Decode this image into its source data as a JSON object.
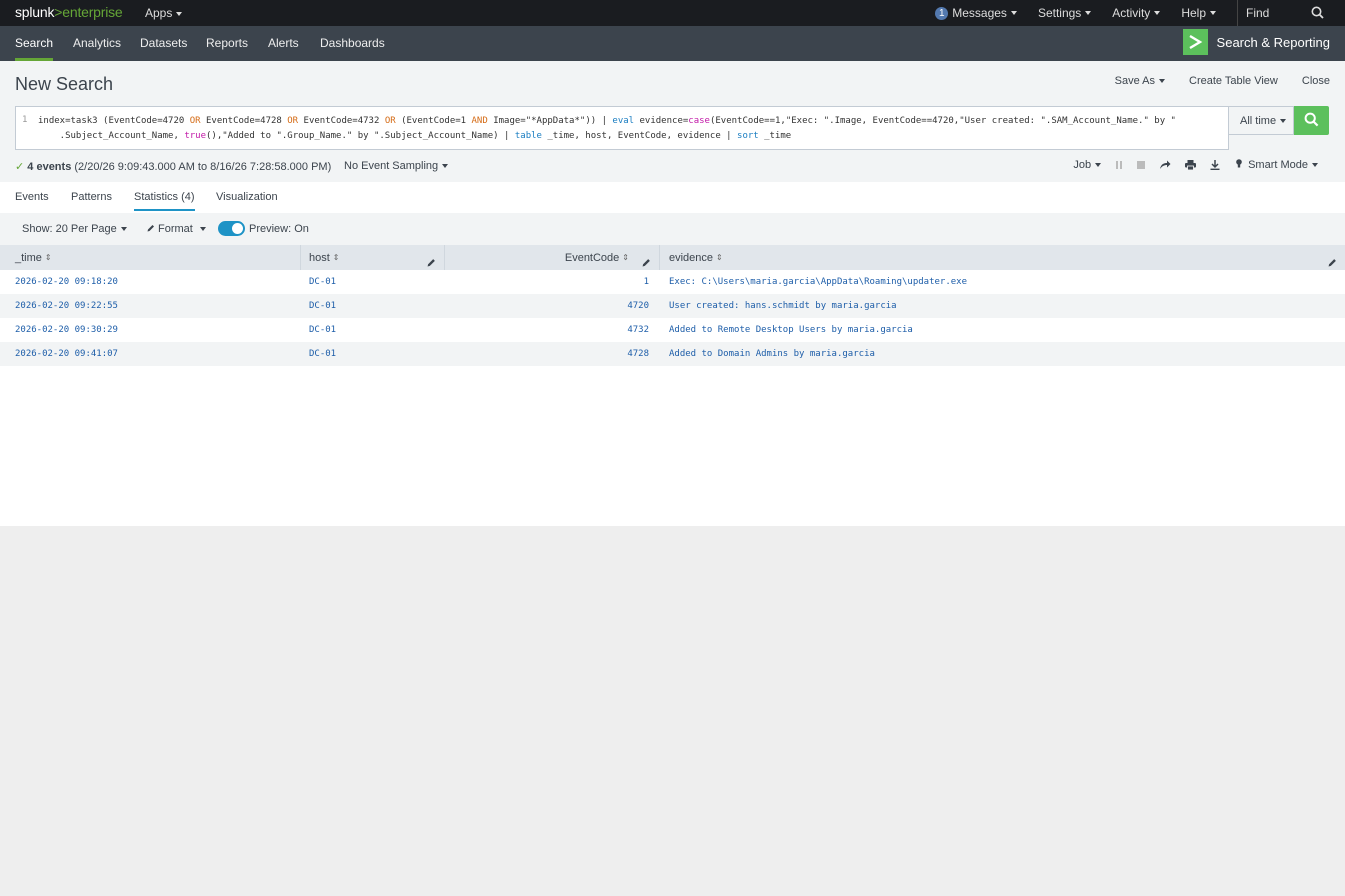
{
  "topbar": {
    "logo_splunk": "splunk",
    "logo_gt": ">",
    "logo_enterprise": "enterprise",
    "apps": "Apps",
    "messages_count": "1",
    "messages": "Messages",
    "settings": "Settings",
    "activity": "Activity",
    "help": "Help",
    "find_placeholder": "Find"
  },
  "appbar": {
    "tabs": [
      "Search",
      "Analytics",
      "Datasets",
      "Reports",
      "Alerts",
      "Dashboards"
    ],
    "app_title": "Search & Reporting"
  },
  "search": {
    "page_title": "New Search",
    "save_as": "Save As",
    "create_table_view": "Create Table View",
    "close": "Close",
    "line_number": "1",
    "query_parts": {
      "p1": "index=task3 (EventCode=4720 ",
      "or1": "OR",
      "p2": " EventCode=4728 ",
      "or2": "OR",
      "p3": " EventCode=4732 ",
      "or3": "OR",
      "p4": " (EventCode=1 ",
      "and1": "AND",
      "p5": " Image=\"*AppData*\")) | ",
      "eval": "eval",
      "p6": " evidence=",
      "case": "case",
      "p7": "(EventCode==1,\"Exec: \".Image, EventCode==4720,\"User created: \".SAM_Account_Name.\" by \"",
      "p8": "    .Subject_Account_Name, ",
      "true": "true",
      "p9": "(),\"Added to \".Group_Name.\" by \".Subject_Account_Name) | ",
      "table": "table",
      "p10": " _time, host, EventCode, evidence | ",
      "sort": "sort",
      "p11": " _time"
    },
    "time_range": "All time",
    "status_count": "4 events",
    "status_range": "(2/20/26 9:09:43.000 AM to 8/16/26 7:28:58.000 PM)",
    "sampling": "No Event Sampling",
    "job": "Job",
    "mode": "Smart Mode"
  },
  "result_tabs": [
    "Events",
    "Patterns",
    "Statistics (4)",
    "Visualization"
  ],
  "toolbar": {
    "per_page": "Show: 20 Per Page",
    "format": "Format",
    "preview": "Preview: On"
  },
  "table": {
    "columns": [
      "_time",
      "host",
      "EventCode",
      "evidence"
    ],
    "rows": [
      {
        "time": "2026-02-20 09:18:20",
        "host": "DC-01",
        "code": "1",
        "evidence": "Exec: C:\\Users\\maria.garcia\\AppData\\Roaming\\updater.exe"
      },
      {
        "time": "2026-02-20 09:22:55",
        "host": "DC-01",
        "code": "4720",
        "evidence": "User created: hans.schmidt by maria.garcia"
      },
      {
        "time": "2026-02-20 09:30:29",
        "host": "DC-01",
        "code": "4732",
        "evidence": "Added to Remote Desktop Users by maria.garcia"
      },
      {
        "time": "2026-02-20 09:41:07",
        "host": "DC-01",
        "code": "4728",
        "evidence": "Added to Domain Admins by maria.garcia"
      }
    ]
  },
  "colors": {
    "brand_green": "#65a637",
    "go_green": "#5cc05c",
    "accent_blue": "#1e93c6",
    "link_blue": "#1e5ea9"
  }
}
